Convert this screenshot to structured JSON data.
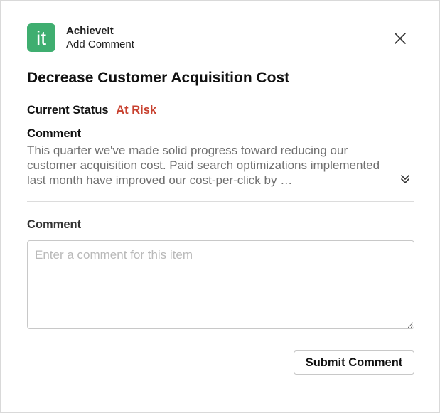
{
  "header": {
    "app_name": "AchieveIt",
    "subtitle": "Add Comment",
    "app_icon": "achieveit-logo-icon",
    "app_icon_color": "#3fae70",
    "app_icon_text": "it",
    "close_icon": "close-icon"
  },
  "item": {
    "title": "Decrease Customer Acquisition Cost",
    "status_label": "Current Status",
    "status_value": "At Risk",
    "status_color": "#c8412f"
  },
  "existing_comment": {
    "heading": "Comment",
    "text": "This quarter we've made solid progress toward reducing our customer acquisition cost. Paid search optimizations implemented last month have improved our cost-per-click by …",
    "expand_icon": "chevron-double-down-icon"
  },
  "new_comment": {
    "label": "Comment",
    "placeholder": "Enter a comment for this item",
    "value": ""
  },
  "actions": {
    "submit_label": "Submit Comment"
  }
}
